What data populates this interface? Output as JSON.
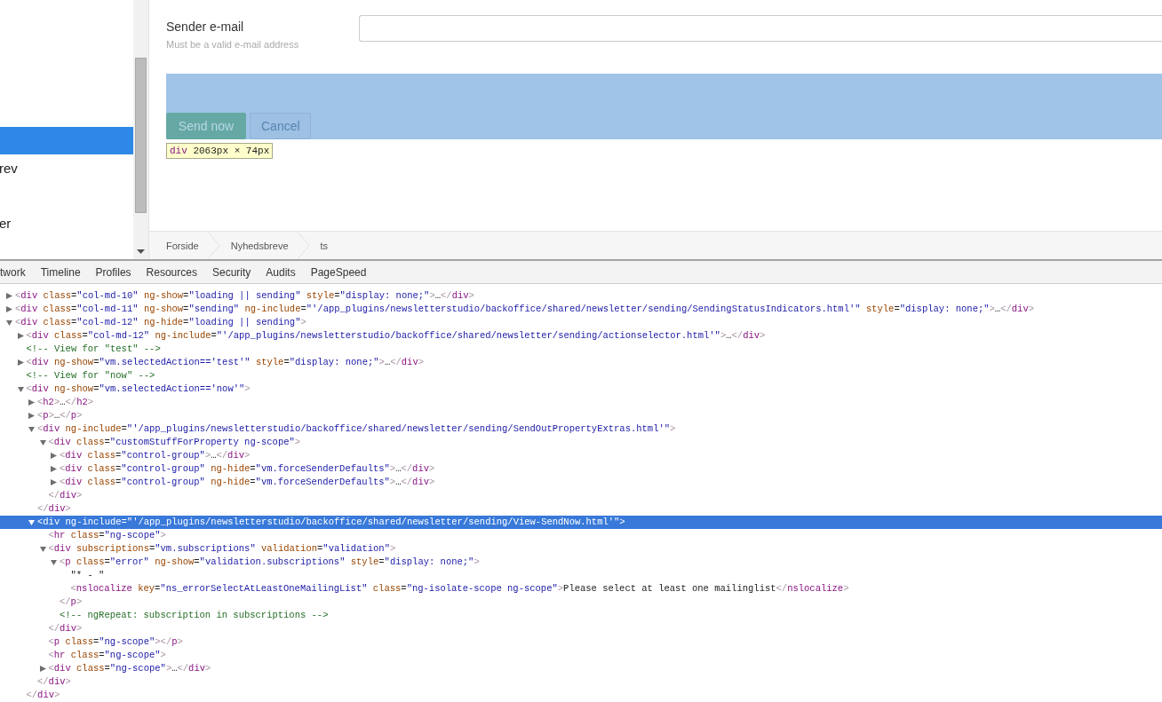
{
  "sidebar": {
    "items": [
      {
        "selected": true
      },
      {
        "label": "rev",
        "selected": false
      },
      {
        "label": "er",
        "selected": false
      }
    ]
  },
  "form": {
    "label": "Sender e-mail",
    "hint": "Must be a valid e-mail address",
    "buttons": [
      {
        "label": "Send now",
        "kind": "primary"
      },
      {
        "label": "Cancel",
        "kind": "secondary"
      }
    ]
  },
  "inspect_tooltip": {
    "tag": "div",
    "dimensions": "2063px × 74px"
  },
  "breadcrumb": [
    "Forside",
    "Nyhedsbreve",
    "ts"
  ],
  "devtools": {
    "tabs": [
      {
        "label": "twork",
        "selected": false
      },
      {
        "label": "Timeline",
        "selected": false
      },
      {
        "label": "Profiles",
        "selected": false
      },
      {
        "label": "Resources",
        "selected": false
      },
      {
        "label": "Security",
        "selected": false
      },
      {
        "label": "Audits",
        "selected": false
      },
      {
        "label": "PageSpeed",
        "selected": false
      }
    ],
    "dom_tree": [
      {
        "kind": "element",
        "text": "<div class=\"col-md-10\" ng-show=\"loading || sending\" style=\"display: none;\">…</div>",
        "expanded": false,
        "selected": false
      },
      {
        "kind": "element",
        "text": "<div class=\"col-md-11\" ng-show=\"sending\" ng-include=\"'/app_plugins/newsletterstudio/backoffice/shared/newsletter/sending/SendingStatusIndicators.html'\" style=\"display: none;\">…</div>",
        "expanded": false,
        "selected": false
      },
      {
        "kind": "element",
        "text": "<div class=\"col-md-12\" ng-hide=\"loading || sending\">",
        "expanded": true,
        "selected": false,
        "children": [
          {
            "kind": "element",
            "text": "<div class=\"col-md-12\" ng-include=\"'/app_plugins/newsletterstudio/backoffice/shared/newsletter/sending/actionselector.html'\">…</div>",
            "expanded": false,
            "selected": false
          },
          {
            "kind": "comment",
            "text": "<!-- View for \"test\" -->",
            "selected": false
          },
          {
            "kind": "element",
            "text": "<div ng-show=\"vm.selectedAction=='test'\" style=\"display: none;\">…</div>",
            "expanded": false,
            "selected": false
          },
          {
            "kind": "comment",
            "text": "<!-- View for \"now\" -->",
            "selected": false
          },
          {
            "kind": "element",
            "text": "<div ng-show=\"vm.selectedAction=='now'\">",
            "expanded": true,
            "selected": false,
            "close": "</div>",
            "children": [
              {
                "kind": "element",
                "text": "<h2>…</h2>",
                "expanded": false,
                "selected": false
              },
              {
                "kind": "element",
                "text": "<p>…</p>",
                "expanded": false,
                "selected": false
              },
              {
                "kind": "element",
                "text": "<div ng-include=\"'/app_plugins/newsletterstudio/backoffice/shared/newsletter/sending/SendOutPropertyExtras.html'\">",
                "expanded": true,
                "selected": false,
                "close": "</div>",
                "children": [
                  {
                    "kind": "element",
                    "text": "<div class=\"customStuffForProperty ng-scope\">",
                    "expanded": true,
                    "selected": false,
                    "close": "</div>",
                    "children": [
                      {
                        "kind": "element",
                        "text": "<div class=\"control-group\">…</div>",
                        "expanded": false,
                        "selected": false
                      },
                      {
                        "kind": "element",
                        "text": "<div class=\"control-group\" ng-hide=\"vm.forceSenderDefaults\">…</div>",
                        "expanded": false,
                        "selected": false
                      },
                      {
                        "kind": "element",
                        "text": "<div class=\"control-group\" ng-hide=\"vm.forceSenderDefaults\">…</div>",
                        "expanded": false,
                        "selected": false
                      }
                    ]
                  }
                ]
              },
              {
                "kind": "element",
                "text": "<div ng-include=\"'/app_plugins/newsletterstudio/backoffice/shared/newsletter/sending/View-SendNow.html'\">",
                "expanded": true,
                "selected": true,
                "close": "</div>",
                "children": [
                  {
                    "kind": "element",
                    "text": "<hr class=\"ng-scope\">",
                    "selected": false
                  },
                  {
                    "kind": "element",
                    "text": "<div subscriptions=\"vm.subscriptions\" validation=\"validation\">",
                    "expanded": true,
                    "selected": false,
                    "close": "</div>",
                    "children": [
                      {
                        "kind": "element",
                        "text": "<p class=\"error\" ng-show=\"validation.subscriptions\" style=\"display: none;\">",
                        "expanded": true,
                        "selected": false,
                        "close": "</p>",
                        "children": [
                          {
                            "kind": "text",
                            "text": "\"* - \"",
                            "selected": false
                          },
                          {
                            "kind": "element",
                            "text": "<nslocalize key=\"ns_errorSelectAtLeastOneMailingList\" class=\"ng-isolate-scope ng-scope\">Please select at least one mailinglist</nslocalize>",
                            "selected": false
                          }
                        ]
                      },
                      {
                        "kind": "comment",
                        "text": "<!-- ngRepeat: subscription in subscriptions -->",
                        "selected": false
                      }
                    ]
                  },
                  {
                    "kind": "element",
                    "text": "<p class=\"ng-scope\"></p>",
                    "selected": false
                  },
                  {
                    "kind": "element",
                    "text": "<hr class=\"ng-scope\">",
                    "selected": false
                  },
                  {
                    "kind": "element",
                    "text": "<div class=\"ng-scope\">…</div>",
                    "expanded": false,
                    "selected": false
                  }
                ]
              }
            ]
          }
        ]
      }
    ]
  }
}
